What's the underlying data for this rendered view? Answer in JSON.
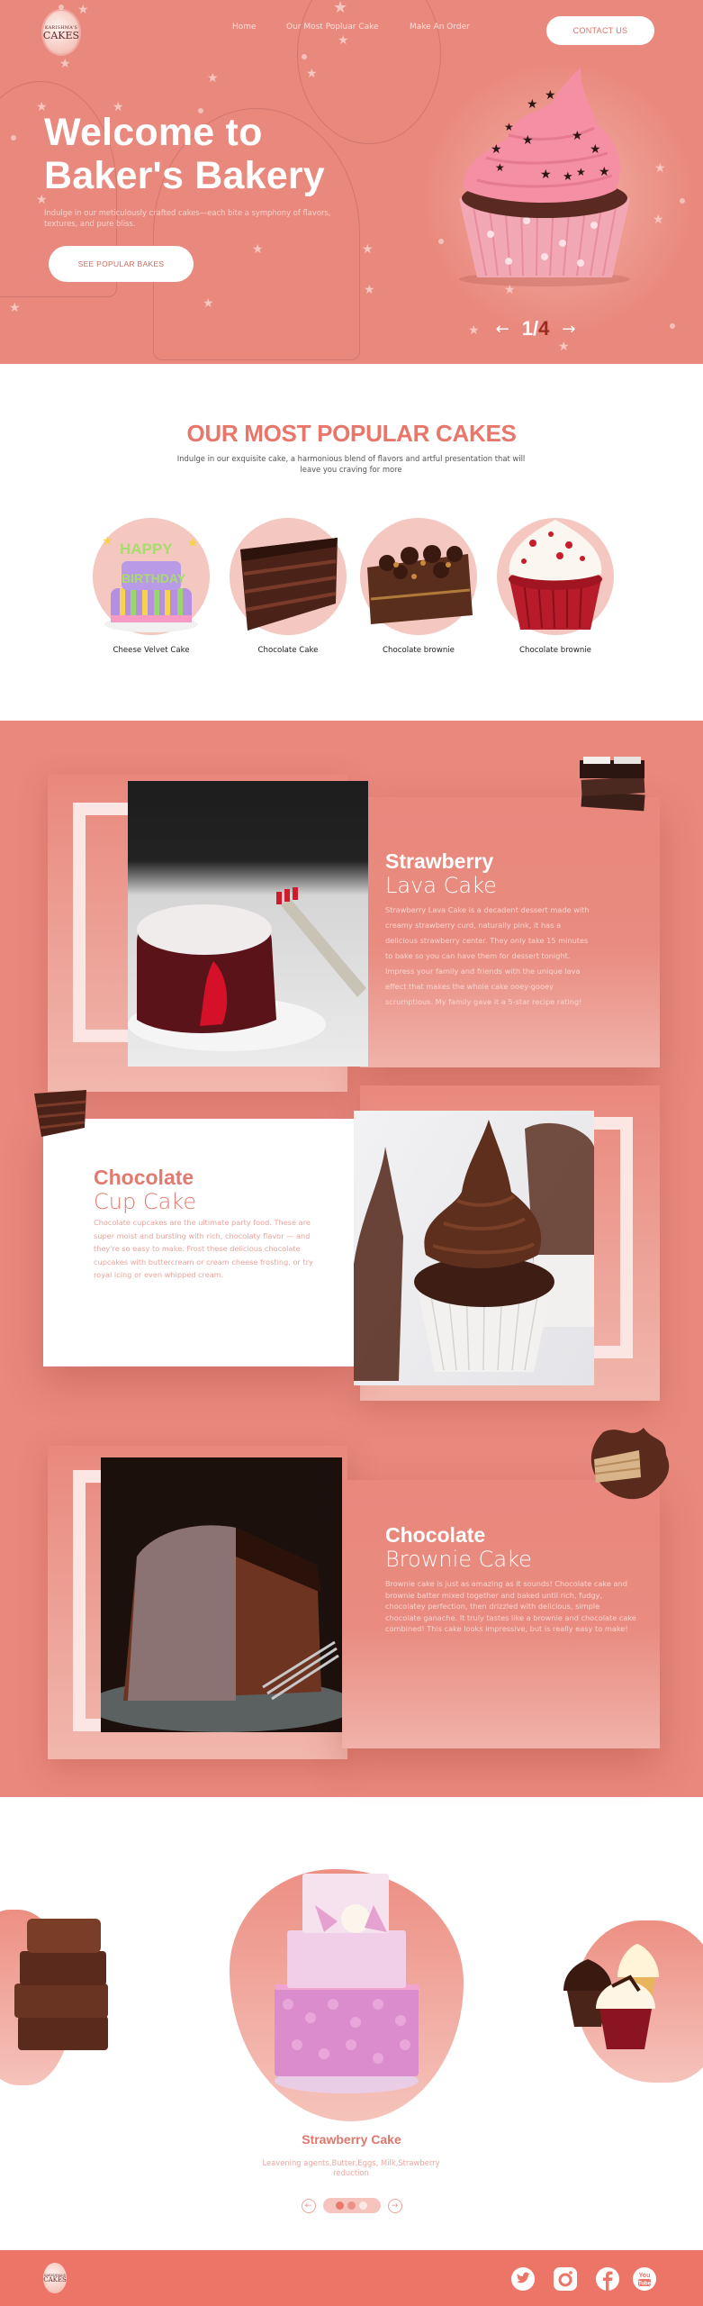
{
  "header": {
    "logo": {
      "line1": "KARISHMA'S",
      "line2": "CAKES"
    },
    "nav": [
      {
        "label": "Home"
      },
      {
        "label": "Our Most Popluar Cake"
      },
      {
        "label": "Make An Order"
      }
    ],
    "contact_label": "CONTACT US"
  },
  "hero": {
    "title_line1": "Welcome to",
    "title_line2": "Baker's Bakery",
    "subtitle": "Indulge in our meticulously crafted cakes—each bite a symphony of flavors, textures, and pure bliss.",
    "cta_label": "SEE POPULAR BAKES",
    "slider": {
      "current": "1",
      "separator": "/",
      "total": "4",
      "prev_icon": "←",
      "next_icon": "→"
    }
  },
  "popular": {
    "title": "OUR MOST POPULAR CAKES",
    "subtitle": "Indulge in our exquisite cake, a harmonious blend of flavors and artful presentation that will leave you craving for more",
    "items": [
      {
        "name": "Cheese Velvet Cake",
        "image": "birthday-cake"
      },
      {
        "name": "Chocolate Cake",
        "image": "chocolate-cake-slice"
      },
      {
        "name": "Chocolate brownie",
        "image": "brownie-square"
      },
      {
        "name": "Chocolate brownie",
        "image": "red-velvet-cupcake"
      }
    ]
  },
  "features": [
    {
      "title": "Strawberry",
      "subtitle": "Lava Cake",
      "body": "Strawberry Lava Cake is a decadent dessert made with creamy strawberry curd, naturally pink, it has a delicious strawberry center. They only take 15 minutes to bake so you can have them for dessert tonight. Impress your family and friends with the unique lava effect that makes the whole cake ooey-gooey scrumptious. My family gave it a 5-star recipe rating!",
      "image": "lava-cake-photo",
      "decor": "chocolate-pieces"
    },
    {
      "title": "Chocolate",
      "subtitle": "Cup Cake",
      "body": "Chocolate cupcakes are the ultimate party food. These are super moist and bursting with rich, chocolaty flavor — and they're so easy to make. Frost these delicious chocolate cupcakes with buttercream or cream cheese frosting, or try royal icing or even whipped cream.",
      "image": "chocolate-cupcake-photo",
      "decor": "cake-slice"
    },
    {
      "title": "Chocolate",
      "subtitle": "Brownie Cake",
      "body": "Brownie cake is just as amazing as it sounds! Chocolate cake and brownie batter mixed together and baked until rich, fudgy, chocolatey perfection, then drizzled with delicious, simple chocolate ganache. It truly tastes like a brownie and chocolate cake combined! This cake looks impressive, but is really easy to make!",
      "image": "brownie-cake-photo",
      "decor": "wafer-chocolate-splash"
    }
  ],
  "showcase": {
    "title": "Strawberry Cake",
    "description": "Leavening agents,Butter,Eggs, Milk,Strawberry reduction",
    "prev_icon": "←",
    "next_icon": "→",
    "dots_total": 3,
    "side_left": "brownie-stack",
    "side_right": "cupcake-trio"
  },
  "footer": {
    "logo": {
      "line1": "KARISHMA'S",
      "line2": "CAKES"
    },
    "social": [
      {
        "name": "twitter"
      },
      {
        "name": "instagram"
      },
      {
        "name": "facebook"
      },
      {
        "name": "youtube",
        "label_top": "You",
        "label_bottom": "Tube"
      }
    ]
  },
  "colors": {
    "primary": "#e9887d",
    "accent_text": "#e8766a",
    "footer": "#ec7568",
    "dark_accent": "#9b2b21"
  }
}
